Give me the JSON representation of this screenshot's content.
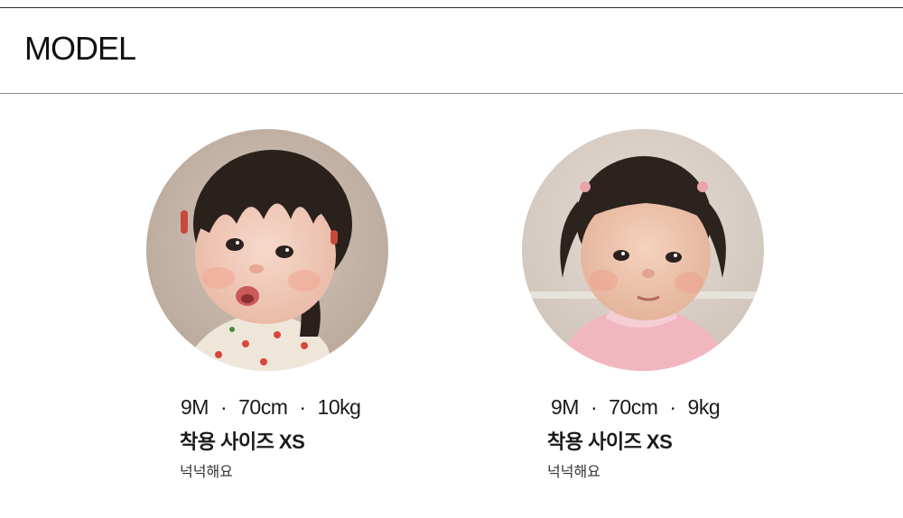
{
  "section": {
    "title": "MODEL"
  },
  "models": [
    {
      "age": "9M",
      "height": "70cm",
      "weight": "10kg",
      "separator": "·",
      "size_label": "착용 사이즈 XS",
      "fit_note": "넉넉해요",
      "photo_icon": "baby-portrait-photo"
    },
    {
      "age": "9M",
      "height": "70cm",
      "weight": "9kg",
      "separator": "·",
      "size_label": "착용 사이즈 XS",
      "fit_note": "넉넉해요",
      "photo_icon": "baby-portrait-photo"
    }
  ],
  "colors": {
    "text": "#1a1a1a",
    "rule_dark": "#2a2a2a",
    "rule_light": "#8a8a8a",
    "photo_bg_1": "#c7b7a9",
    "photo_bg_2": "#ddd3cc"
  }
}
